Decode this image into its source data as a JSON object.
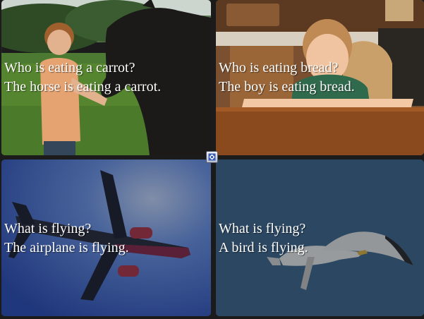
{
  "tiles": [
    {
      "question": "Who is eating a carrot?",
      "answer": "The horse is eating a carrot."
    },
    {
      "question": "Who is eating bread?",
      "answer": "The boy is eating bread."
    },
    {
      "question": "What is flying?",
      "answer": "The airplane is flying."
    },
    {
      "question": "What is flying?",
      "answer": "A bird is flying."
    }
  ],
  "controls": {
    "expand_icon": "expand-arrows-icon"
  },
  "colors": {
    "caption_text": "#ffffff",
    "gutter": "#1b1b1b"
  }
}
